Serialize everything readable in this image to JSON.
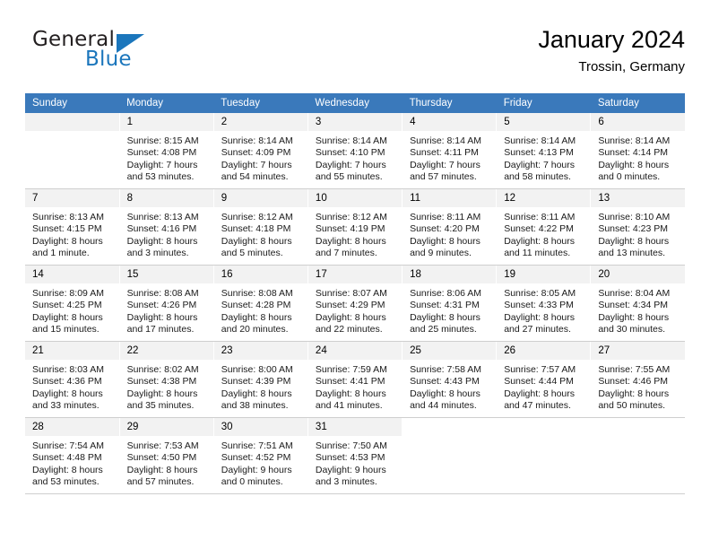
{
  "brand": {
    "name_part1": "General",
    "name_part2": "Blue",
    "triangle_icon": "triangle-icon",
    "accent_color": "#1b76bc"
  },
  "header": {
    "title": "January 2024",
    "subtitle": "Trossin, Germany"
  },
  "calendar": {
    "header_color": "#3a79bb",
    "weekday_headers": [
      "Sunday",
      "Monday",
      "Tuesday",
      "Wednesday",
      "Thursday",
      "Friday",
      "Saturday"
    ],
    "labels": {
      "sunrise": "Sunrise:",
      "sunset": "Sunset:",
      "daylight": "Daylight:"
    },
    "weeks": [
      [
        {
          "day": "",
          "blank": true
        },
        {
          "day": "1",
          "sunrise": "Sunrise: 8:15 AM",
          "sunset": "Sunset: 4:08 PM",
          "daylight_line1": "Daylight: 7 hours",
          "daylight_line2": "and 53 minutes."
        },
        {
          "day": "2",
          "sunrise": "Sunrise: 8:14 AM",
          "sunset": "Sunset: 4:09 PM",
          "daylight_line1": "Daylight: 7 hours",
          "daylight_line2": "and 54 minutes."
        },
        {
          "day": "3",
          "sunrise": "Sunrise: 8:14 AM",
          "sunset": "Sunset: 4:10 PM",
          "daylight_line1": "Daylight: 7 hours",
          "daylight_line2": "and 55 minutes."
        },
        {
          "day": "4",
          "sunrise": "Sunrise: 8:14 AM",
          "sunset": "Sunset: 4:11 PM",
          "daylight_line1": "Daylight: 7 hours",
          "daylight_line2": "and 57 minutes."
        },
        {
          "day": "5",
          "sunrise": "Sunrise: 8:14 AM",
          "sunset": "Sunset: 4:13 PM",
          "daylight_line1": "Daylight: 7 hours",
          "daylight_line2": "and 58 minutes."
        },
        {
          "day": "6",
          "sunrise": "Sunrise: 8:14 AM",
          "sunset": "Sunset: 4:14 PM",
          "daylight_line1": "Daylight: 8 hours",
          "daylight_line2": "and 0 minutes."
        }
      ],
      [
        {
          "day": "7",
          "sunrise": "Sunrise: 8:13 AM",
          "sunset": "Sunset: 4:15 PM",
          "daylight_line1": "Daylight: 8 hours",
          "daylight_line2": "and 1 minute."
        },
        {
          "day": "8",
          "sunrise": "Sunrise: 8:13 AM",
          "sunset": "Sunset: 4:16 PM",
          "daylight_line1": "Daylight: 8 hours",
          "daylight_line2": "and 3 minutes."
        },
        {
          "day": "9",
          "sunrise": "Sunrise: 8:12 AM",
          "sunset": "Sunset: 4:18 PM",
          "daylight_line1": "Daylight: 8 hours",
          "daylight_line2": "and 5 minutes."
        },
        {
          "day": "10",
          "sunrise": "Sunrise: 8:12 AM",
          "sunset": "Sunset: 4:19 PM",
          "daylight_line1": "Daylight: 8 hours",
          "daylight_line2": "and 7 minutes."
        },
        {
          "day": "11",
          "sunrise": "Sunrise: 8:11 AM",
          "sunset": "Sunset: 4:20 PM",
          "daylight_line1": "Daylight: 8 hours",
          "daylight_line2": "and 9 minutes."
        },
        {
          "day": "12",
          "sunrise": "Sunrise: 8:11 AM",
          "sunset": "Sunset: 4:22 PM",
          "daylight_line1": "Daylight: 8 hours",
          "daylight_line2": "and 11 minutes."
        },
        {
          "day": "13",
          "sunrise": "Sunrise: 8:10 AM",
          "sunset": "Sunset: 4:23 PM",
          "daylight_line1": "Daylight: 8 hours",
          "daylight_line2": "and 13 minutes."
        }
      ],
      [
        {
          "day": "14",
          "sunrise": "Sunrise: 8:09 AM",
          "sunset": "Sunset: 4:25 PM",
          "daylight_line1": "Daylight: 8 hours",
          "daylight_line2": "and 15 minutes."
        },
        {
          "day": "15",
          "sunrise": "Sunrise: 8:08 AM",
          "sunset": "Sunset: 4:26 PM",
          "daylight_line1": "Daylight: 8 hours",
          "daylight_line2": "and 17 minutes."
        },
        {
          "day": "16",
          "sunrise": "Sunrise: 8:08 AM",
          "sunset": "Sunset: 4:28 PM",
          "daylight_line1": "Daylight: 8 hours",
          "daylight_line2": "and 20 minutes."
        },
        {
          "day": "17",
          "sunrise": "Sunrise: 8:07 AM",
          "sunset": "Sunset: 4:29 PM",
          "daylight_line1": "Daylight: 8 hours",
          "daylight_line2": "and 22 minutes."
        },
        {
          "day": "18",
          "sunrise": "Sunrise: 8:06 AM",
          "sunset": "Sunset: 4:31 PM",
          "daylight_line1": "Daylight: 8 hours",
          "daylight_line2": "and 25 minutes."
        },
        {
          "day": "19",
          "sunrise": "Sunrise: 8:05 AM",
          "sunset": "Sunset: 4:33 PM",
          "daylight_line1": "Daylight: 8 hours",
          "daylight_line2": "and 27 minutes."
        },
        {
          "day": "20",
          "sunrise": "Sunrise: 8:04 AM",
          "sunset": "Sunset: 4:34 PM",
          "daylight_line1": "Daylight: 8 hours",
          "daylight_line2": "and 30 minutes."
        }
      ],
      [
        {
          "day": "21",
          "sunrise": "Sunrise: 8:03 AM",
          "sunset": "Sunset: 4:36 PM",
          "daylight_line1": "Daylight: 8 hours",
          "daylight_line2": "and 33 minutes."
        },
        {
          "day": "22",
          "sunrise": "Sunrise: 8:02 AM",
          "sunset": "Sunset: 4:38 PM",
          "daylight_line1": "Daylight: 8 hours",
          "daylight_line2": "and 35 minutes."
        },
        {
          "day": "23",
          "sunrise": "Sunrise: 8:00 AM",
          "sunset": "Sunset: 4:39 PM",
          "daylight_line1": "Daylight: 8 hours",
          "daylight_line2": "and 38 minutes."
        },
        {
          "day": "24",
          "sunrise": "Sunrise: 7:59 AM",
          "sunset": "Sunset: 4:41 PM",
          "daylight_line1": "Daylight: 8 hours",
          "daylight_line2": "and 41 minutes."
        },
        {
          "day": "25",
          "sunrise": "Sunrise: 7:58 AM",
          "sunset": "Sunset: 4:43 PM",
          "daylight_line1": "Daylight: 8 hours",
          "daylight_line2": "and 44 minutes."
        },
        {
          "day": "26",
          "sunrise": "Sunrise: 7:57 AM",
          "sunset": "Sunset: 4:44 PM",
          "daylight_line1": "Daylight: 8 hours",
          "daylight_line2": "and 47 minutes."
        },
        {
          "day": "27",
          "sunrise": "Sunrise: 7:55 AM",
          "sunset": "Sunset: 4:46 PM",
          "daylight_line1": "Daylight: 8 hours",
          "daylight_line2": "and 50 minutes."
        }
      ],
      [
        {
          "day": "28",
          "sunrise": "Sunrise: 7:54 AM",
          "sunset": "Sunset: 4:48 PM",
          "daylight_line1": "Daylight: 8 hours",
          "daylight_line2": "and 53 minutes."
        },
        {
          "day": "29",
          "sunrise": "Sunrise: 7:53 AM",
          "sunset": "Sunset: 4:50 PM",
          "daylight_line1": "Daylight: 8 hours",
          "daylight_line2": "and 57 minutes."
        },
        {
          "day": "30",
          "sunrise": "Sunrise: 7:51 AM",
          "sunset": "Sunset: 4:52 PM",
          "daylight_line1": "Daylight: 9 hours",
          "daylight_line2": "and 0 minutes."
        },
        {
          "day": "31",
          "sunrise": "Sunrise: 7:50 AM",
          "sunset": "Sunset: 4:53 PM",
          "daylight_line1": "Daylight: 9 hours",
          "daylight_line2": "and 3 minutes."
        },
        {
          "day": "",
          "empty": true
        },
        {
          "day": "",
          "empty": true
        },
        {
          "day": "",
          "empty": true
        }
      ]
    ]
  }
}
